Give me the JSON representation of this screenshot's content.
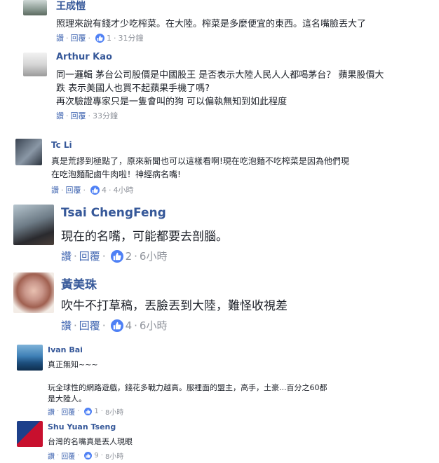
{
  "actions": {
    "read": "讚",
    "reply": "回覆",
    "dot": "·"
  },
  "comments": [
    {
      "name": "王成愷",
      "lines": [
        "照理來說有錢才少吃榨菜。在大陸。榨菜是多麼便宜的東西。這名嘴臉丟大了"
      ],
      "likes": "1",
      "time": "31分鐘"
    },
    {
      "name": "Arthur Kao",
      "lines": [
        "同一邏輯 茅台公司股價是中國股王 是否表示大陸人民人人都喝茅台？ 蘋果股價大",
        "跌 表示美國人也買不起蘋果手機了嗎?",
        "再次驗證專家只是一隻會叫的狗 可以偏執無知到如此程度"
      ],
      "likes": "",
      "time": "33分鐘"
    },
    {
      "name": "Tc Li",
      "lines": [
        "真是荒謬到極點了，原來新聞也可以這樣看啊!現在吃泡麵不吃榨菜是因為他們現",
        "在吃泡麵配鹵牛肉啦！神經病名嘴!"
      ],
      "likes": "4",
      "time": "4小時"
    },
    {
      "name": "Tsai ChengFeng",
      "lines": [
        "現在的名嘴，可能都要去剖腦。"
      ],
      "likes": "2",
      "time": "6小時"
    },
    {
      "name": "黃美珠",
      "lines": [
        "吹牛不打草稿，丟臉丟到大陸，難怪收視差"
      ],
      "likes": "4",
      "time": "6小時"
    },
    {
      "name": "Ivan Bai",
      "lines": [
        "真正無知~~~",
        "",
        "玩全球性的網路遊戲，錢花多戰力越高。服裡面的盟主，高手，土豪...百分之60都",
        "是大陸人。"
      ],
      "likes": "1",
      "time": "8小時"
    },
    {
      "name": "Shu Yuan Tseng",
      "lines": [
        "台灣的名嘴真是丟人現眼"
      ],
      "likes": "9",
      "time": "8小時"
    }
  ]
}
